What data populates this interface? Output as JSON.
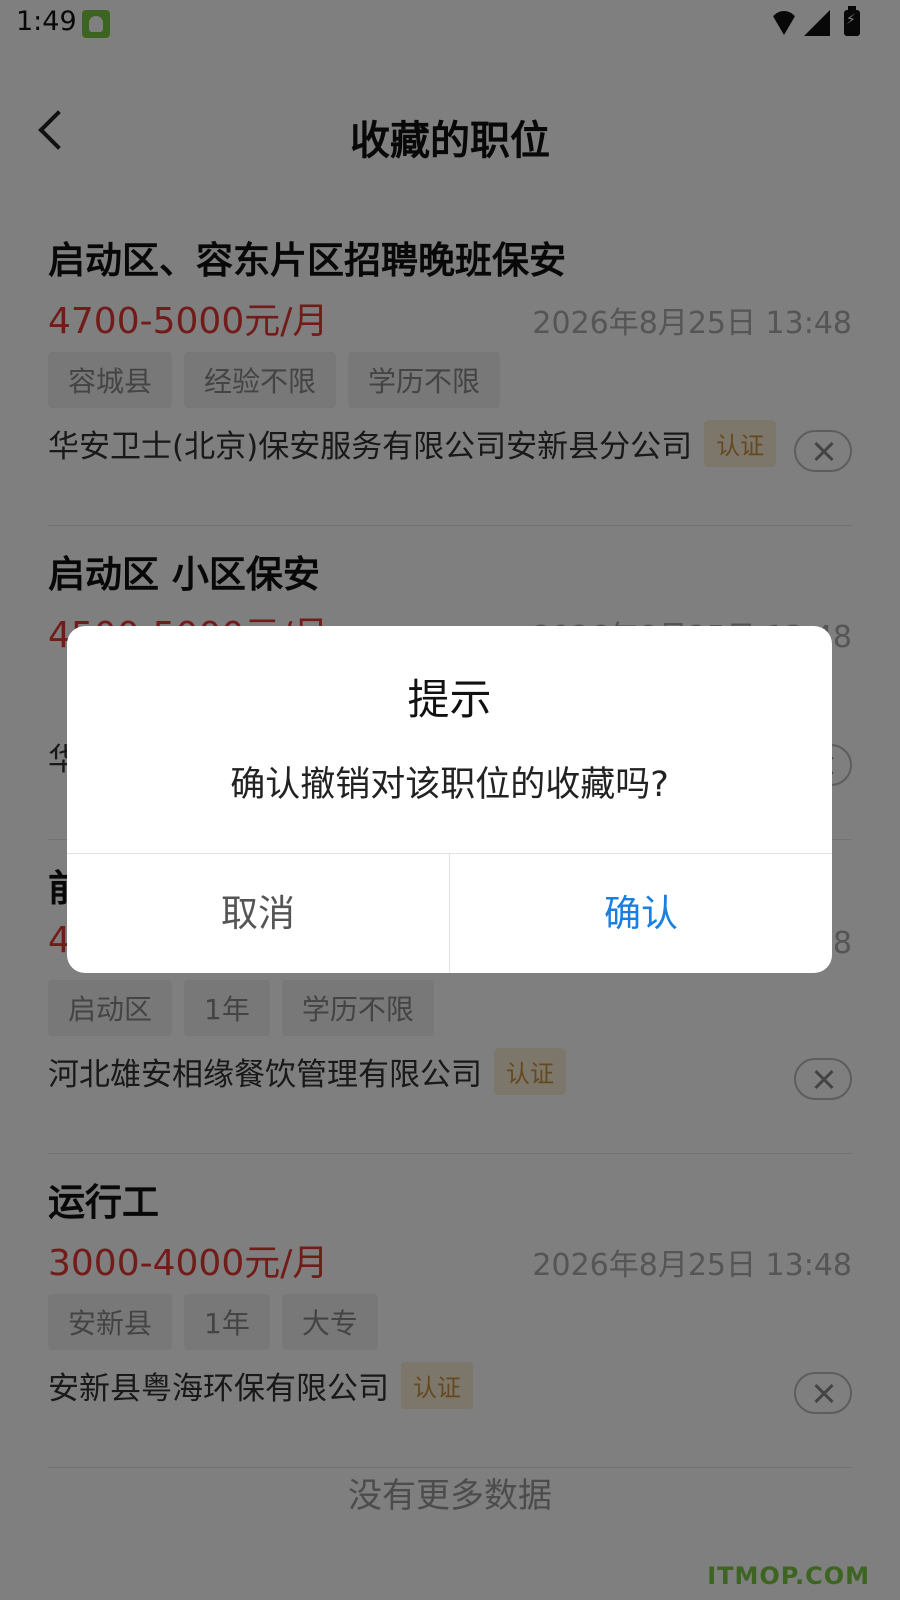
{
  "status_bar": {
    "time": "1:49",
    "icons": [
      "app-notification-icon",
      "wifi-icon",
      "signal-icon",
      "battery-charging-icon"
    ]
  },
  "header": {
    "title": "收藏的职位",
    "back_icon": "chevron-left-icon"
  },
  "jobs": [
    {
      "title": "启动区、容东片区招聘晚班保安",
      "salary": "4700-5000元/月",
      "date": "2026年8月25日 13:48",
      "tags": [
        "容城县",
        "经验不限",
        "学历不限"
      ],
      "company": "华安卫士(北京)保安服务有限公司安新县分公司",
      "badge": "认证"
    },
    {
      "title": "启动区 小区保安",
      "salary": "4500-5000元/月",
      "date": "2026年8月25日 13:48",
      "tags": [],
      "company": "华",
      "badge": ""
    },
    {
      "title": "前",
      "salary": "4",
      "date": "8",
      "tags": [
        "启动区",
        "1年",
        "学历不限"
      ],
      "company": "河北雄安相缘餐饮管理有限公司",
      "badge": "认证"
    },
    {
      "title": "运行工",
      "salary": "3000-4000元/月",
      "date": "2026年8月25日 13:48",
      "tags": [
        "安新县",
        "1年",
        "大专"
      ],
      "company": "安新县粤海环保有限公司",
      "badge": "认证"
    }
  ],
  "footer": {
    "no_more": "没有更多数据"
  },
  "watermark": "ITMOP.COM",
  "dialog": {
    "title": "提示",
    "message": "确认撤销对该职位的收藏吗?",
    "cancel": "取消",
    "confirm": "确认"
  },
  "colors": {
    "salary": "#e53935",
    "confirm": "#1a7fe0",
    "badge_text": "#c9933e",
    "overlay": "rgba(0,0,0,0.5)"
  }
}
